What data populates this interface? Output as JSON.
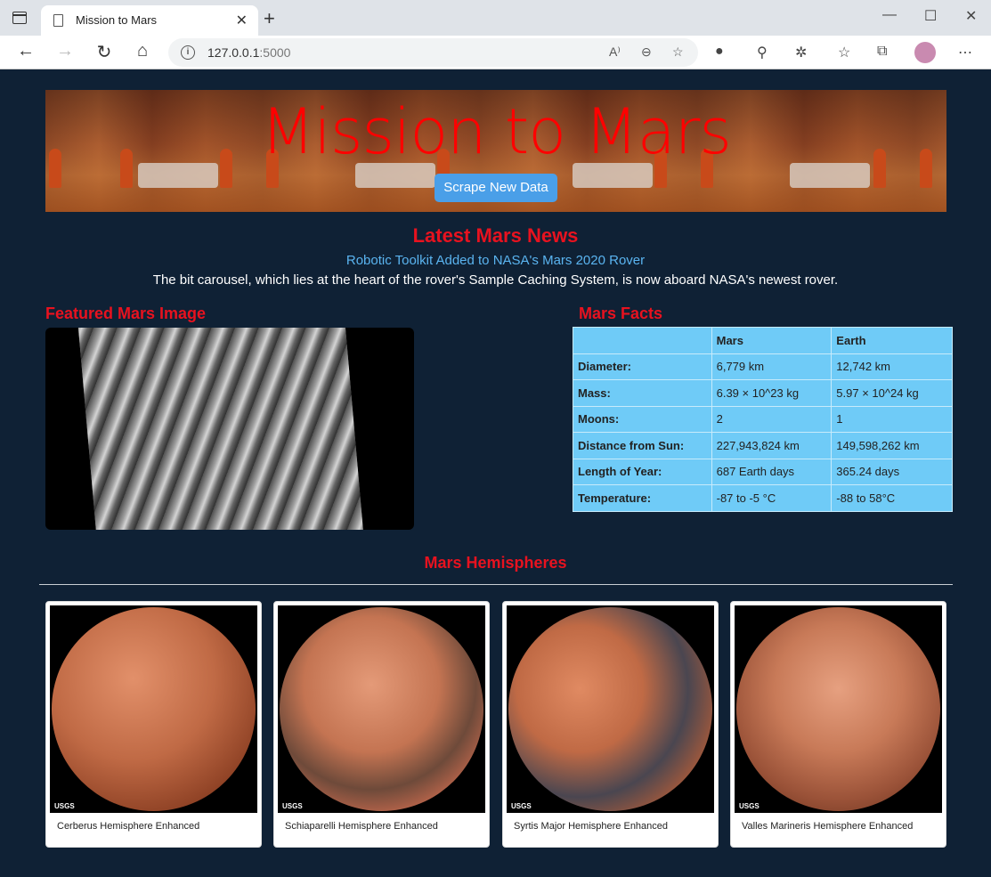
{
  "browser": {
    "tab_title": "Mission to Mars",
    "url_host": "127.0.0.1",
    "url_port": ":5000"
  },
  "jumbotron": {
    "title": "Mission to Mars",
    "button_label": "Scrape New Data"
  },
  "news": {
    "heading": "Latest Mars News",
    "headline": "Robotic Toolkit Added to NASA's Mars 2020 Rover",
    "teaser": "The bit carousel, which lies at the heart of the rover's Sample Caching System, is now aboard NASA's newest rover."
  },
  "featured": {
    "heading": "Featured Mars Image"
  },
  "facts": {
    "heading": "Mars Facts",
    "columns": [
      "",
      "Mars",
      "Earth"
    ],
    "rows": [
      {
        "label": "Diameter:",
        "mars": "6,779 km",
        "earth": "12,742 km"
      },
      {
        "label": "Mass:",
        "mars": "6.39 × 10^23 kg",
        "earth": "5.97 × 10^24 kg"
      },
      {
        "label": "Moons:",
        "mars": "2",
        "earth": "1"
      },
      {
        "label": "Distance from Sun:",
        "mars": "227,943,824 km",
        "earth": "149,598,262 km"
      },
      {
        "label": "Length of Year:",
        "mars": "687 Earth days",
        "earth": "365.24 days"
      },
      {
        "label": "Temperature:",
        "mars": "-87 to -5 °C",
        "earth": "-88 to 58°C"
      }
    ]
  },
  "hemispheres": {
    "heading": "Mars Hemispheres",
    "items": [
      {
        "title": "Cerberus Hemisphere Enhanced",
        "logo": "USGS",
        "color": "#b8603a"
      },
      {
        "title": "Schiaparelli Hemisphere Enhanced",
        "logo": "USGS",
        "color": "#c06a45"
      },
      {
        "title": "Syrtis Major Hemisphere Enhanced",
        "logo": "USGS",
        "color": "#b05838"
      },
      {
        "title": "Valles Marineris Hemisphere Enhanced",
        "logo": "USGS",
        "color": "#b86a48"
      }
    ]
  }
}
